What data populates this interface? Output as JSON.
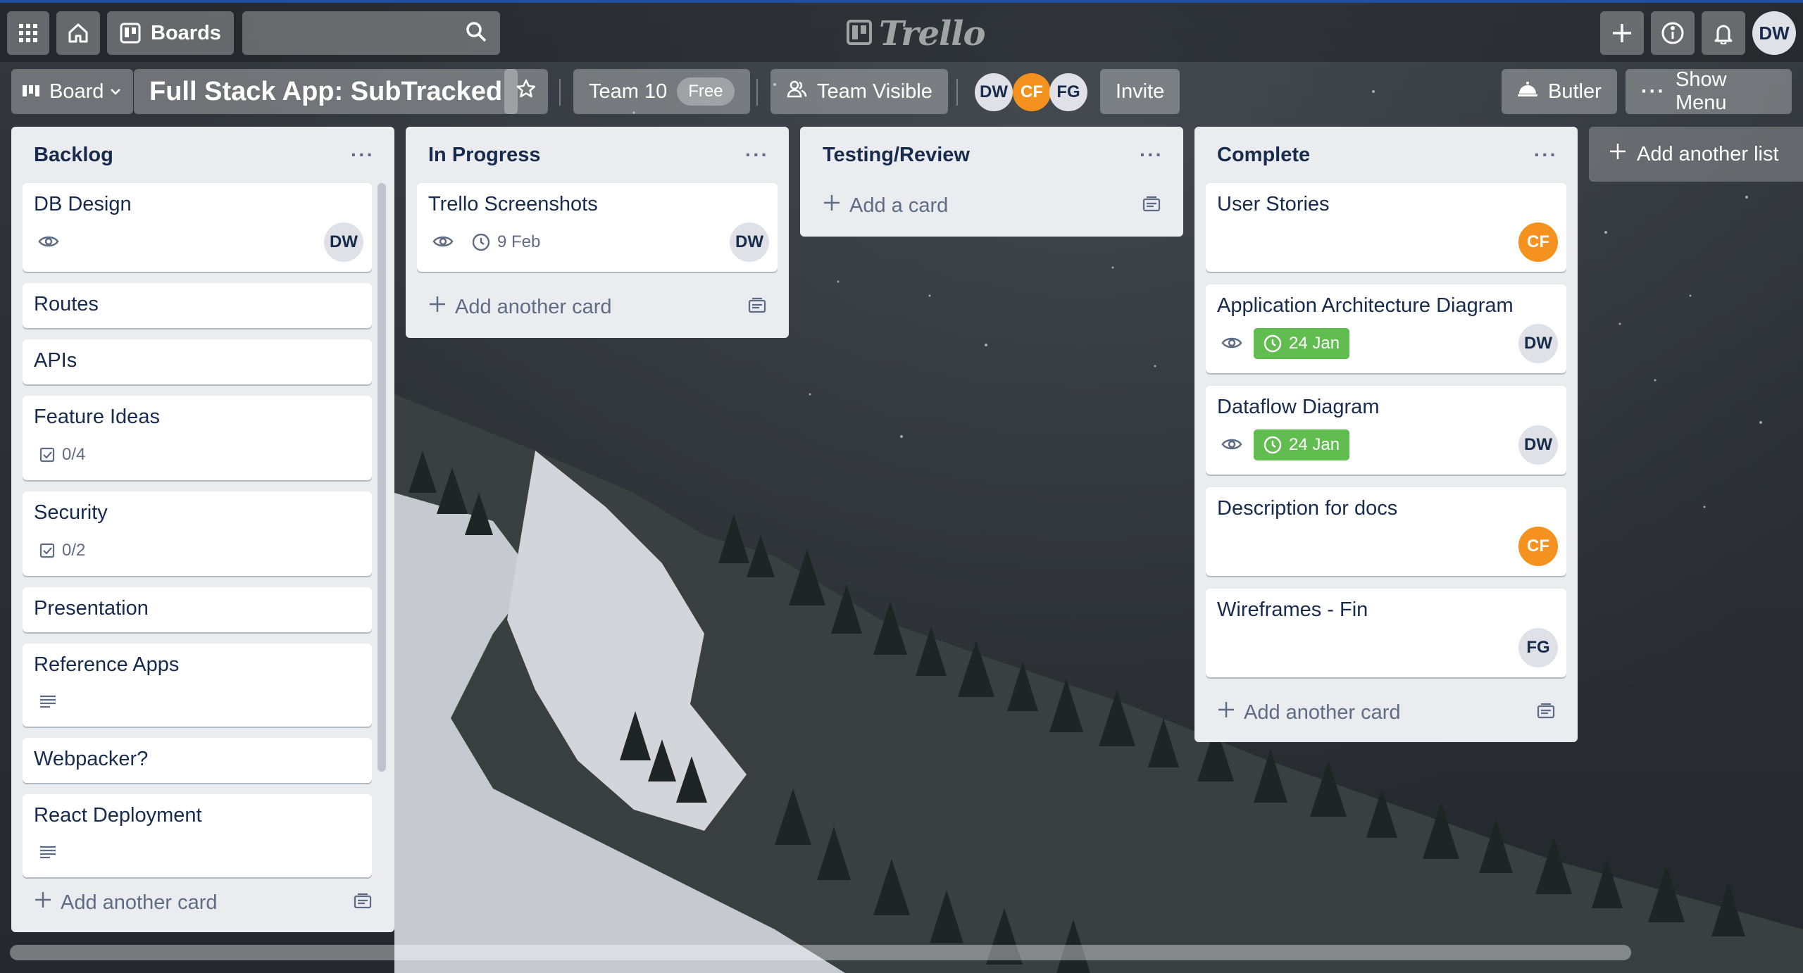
{
  "header": {
    "boards_label": "Boards",
    "search_placeholder": "",
    "logo_text": "Trello",
    "user_initials": "DW"
  },
  "board": {
    "view_label": "Board",
    "title": "Full Stack App: SubTracked",
    "team_name": "Team 10",
    "team_plan": "Free",
    "visibility": "Team Visible",
    "members": [
      "DW",
      "CF",
      "FG"
    ],
    "invite_label": "Invite",
    "butler_label": "Butler",
    "menu_label": "Show Menu",
    "add_list_label": "Add another list"
  },
  "lists": [
    {
      "title": "Backlog",
      "add_label": "Add another card",
      "cards": [
        {
          "title": "DB Design",
          "watch": true,
          "member": "DW"
        },
        {
          "title": "Routes"
        },
        {
          "title": "APIs"
        },
        {
          "title": "Feature Ideas",
          "checklist": "0/4"
        },
        {
          "title": "Security",
          "checklist": "0/2"
        },
        {
          "title": "Presentation"
        },
        {
          "title": "Reference Apps",
          "description": true
        },
        {
          "title": "Webpacker?"
        },
        {
          "title": "React Deployment",
          "description": true
        }
      ]
    },
    {
      "title": "In Progress",
      "add_label": "Add another card",
      "cards": [
        {
          "title": "Trello Screenshots",
          "watch": true,
          "due": "9 Feb",
          "member": "DW"
        }
      ]
    },
    {
      "title": "Testing/Review",
      "add_label": "Add a card",
      "cards": []
    },
    {
      "title": "Complete",
      "add_label": "Add another card",
      "cards": [
        {
          "title": "User Stories",
          "member": "CF"
        },
        {
          "title": "Application Architecture Diagram",
          "watch": true,
          "due": "24 Jan",
          "due_complete": true,
          "member": "DW"
        },
        {
          "title": "Dataflow Diagram",
          "watch": true,
          "due": "24 Jan",
          "due_complete": true,
          "member": "DW"
        },
        {
          "title": "Description for docs",
          "member": "CF"
        },
        {
          "title": "Wireframes - Fin",
          "member": "FG"
        }
      ]
    }
  ],
  "colors": {
    "accent_orange": "#f5911f",
    "due_complete_green": "#61bd4f",
    "list_bg": "#ebecf0"
  }
}
